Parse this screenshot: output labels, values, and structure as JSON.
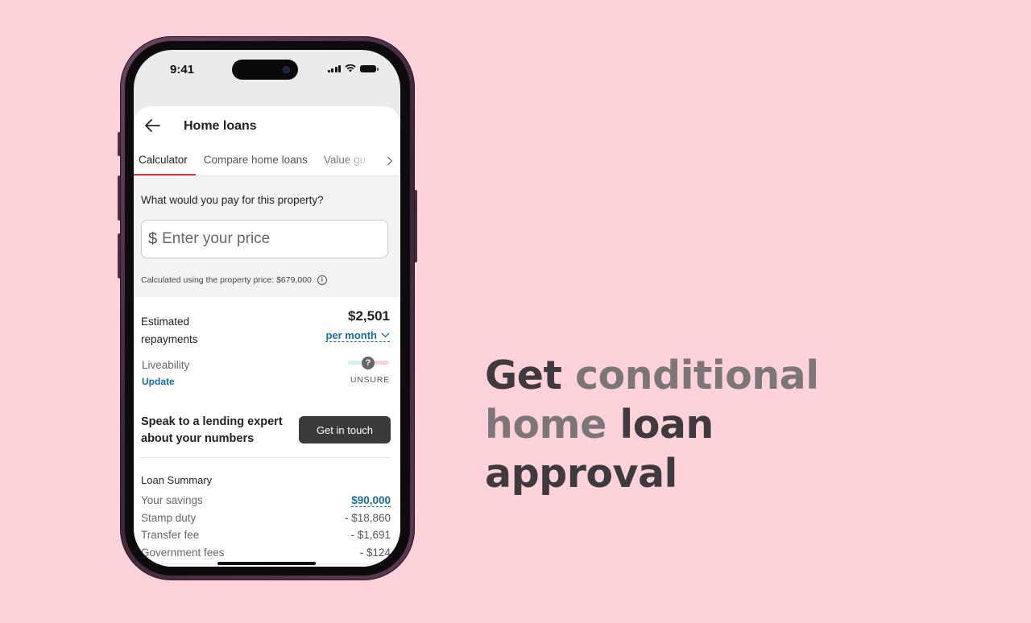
{
  "status_bar": {
    "time": "9:41"
  },
  "header": {
    "title": "Home loans"
  },
  "tabs": [
    {
      "label": "Calculator"
    },
    {
      "label": "Compare home loans"
    },
    {
      "label": "Value gu"
    }
  ],
  "price": {
    "question": "What would you pay for this property?",
    "currency_symbol": "$",
    "placeholder": "Enter your price",
    "note": "Calculated using the property price: $679,000"
  },
  "repayments": {
    "label_line1": "Estimated",
    "label_line2": "repayments",
    "amount": "$2,501",
    "period": "per month"
  },
  "liveability": {
    "label": "Liveability",
    "update": "Update",
    "status": "UNSURE",
    "icon_glyph": "?"
  },
  "expert": {
    "text": "Speak to a lending expert about your numbers",
    "button": "Get in touch"
  },
  "summary": {
    "title": "Loan Summary",
    "rows": [
      {
        "label": "Your savings",
        "value": "$90,000"
      },
      {
        "label": "Stamp duty",
        "value": "- $18,860"
      },
      {
        "label": "Transfer fee",
        "value": "- $1,691"
      },
      {
        "label": "Government fees",
        "value": "- $124"
      }
    ]
  },
  "headline": {
    "w1": "Get",
    "w2": "conditional",
    "w3": "home",
    "w4": "loan",
    "w5": "approval"
  },
  "colors": {
    "background": "#fdd2d8",
    "accent_red": "#d8363f",
    "link_blue": "#1a6d9a",
    "button_dark": "#3a3a3d"
  }
}
